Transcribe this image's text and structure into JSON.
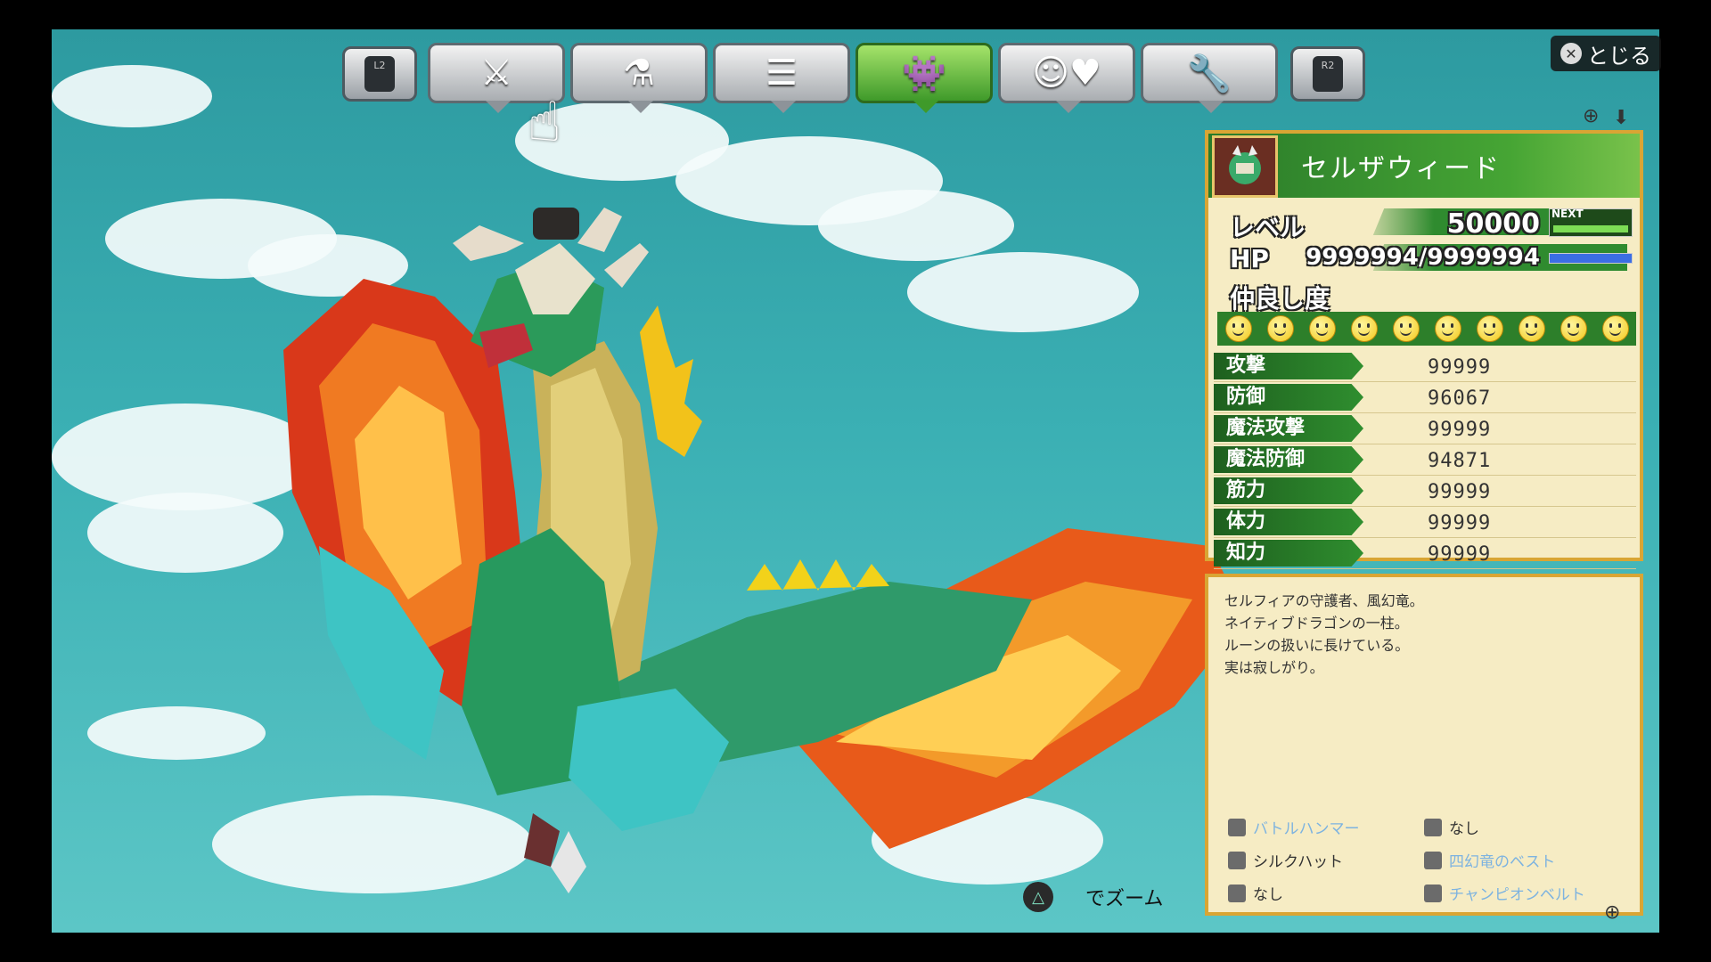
{
  "window": {
    "close_label": "とじる",
    "close_button_glyph": "✕"
  },
  "tabs": [
    {
      "name": "equipment-tab",
      "icon": "sword-shield-icon",
      "glyph": "⚔"
    },
    {
      "name": "items-tab",
      "icon": "potion-hammer-icon",
      "glyph": "⚗"
    },
    {
      "name": "records-tab",
      "icon": "document-icon",
      "glyph": "☰"
    },
    {
      "name": "monsters-tab",
      "icon": "monster-pair-icon",
      "glyph": "👾",
      "active": true
    },
    {
      "name": "friendship-tab",
      "icon": "smile-heart-icon",
      "glyph": "☺♥"
    },
    {
      "name": "settings-tab",
      "icon": "wrench-icon",
      "glyph": "🔧"
    }
  ],
  "nav": {
    "left": "L2",
    "right": "R2"
  },
  "status": {
    "name": "セルザウィード",
    "level_label": "レベル",
    "level_value": "50000",
    "next_label": "NEXT",
    "next_progress": 1.0,
    "hp_label": "HP",
    "hp_value": "9999994/9999994",
    "hp_fraction": 1.0,
    "friendship_label": "仲良し度",
    "friendship_level": 10
  },
  "stats": [
    {
      "label": "攻撃",
      "value": "99999"
    },
    {
      "label": "防御",
      "value": "96067"
    },
    {
      "label": "魔法攻撃",
      "value": "99999"
    },
    {
      "label": "魔法防御",
      "value": "94871"
    },
    {
      "label": "筋力",
      "value": "99999"
    },
    {
      "label": "体力",
      "value": "99999"
    },
    {
      "label": "知力",
      "value": "99999"
    }
  ],
  "description": [
    "セルフィアの守護者、風幻竜。",
    "ネイティブドラゴンの一柱。",
    "ルーンの扱いに長けている。",
    "実は寂しがり。"
  ],
  "equipment": [
    {
      "label": "バトルハンマー",
      "dim": true
    },
    {
      "label": "なし",
      "dim": false
    },
    {
      "label": "シルクハット",
      "dim": false
    },
    {
      "label": "四幻竜のベスト",
      "dim": true
    },
    {
      "label": "なし",
      "dim": false
    },
    {
      "label": "チャンピオンベルト",
      "dim": true
    }
  ],
  "zoom_hint": "でズーム",
  "colors": {
    "accent": "#2f8e2f",
    "panel_border": "#d9a534",
    "panel_bg": "#f6ecc4"
  }
}
